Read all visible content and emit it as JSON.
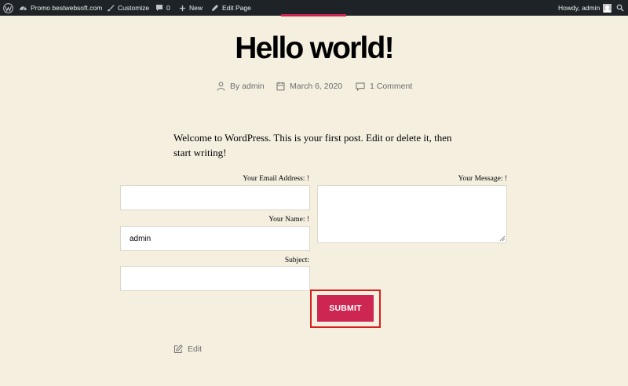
{
  "adminbar": {
    "site_name": "Promo bestwebsoft.com",
    "customize": "Customize",
    "comments_count": "0",
    "new": "New",
    "edit_page": "Edit Page",
    "howdy": "Howdy, admin"
  },
  "post": {
    "title": "Hello world!",
    "author": "By admin",
    "date": "March 6, 2020",
    "comments": "1 Comment",
    "body": "Welcome to WordPress. This is your first post. Edit or delete it, then start writing!",
    "edit": "Edit"
  },
  "form": {
    "email_label": "Your Email Address: !",
    "email_value": "",
    "name_label": "Your Name: !",
    "name_value": "admin",
    "subject_label": "Subject:",
    "subject_value": "",
    "message_label": "Your Message: !",
    "message_value": "",
    "submit_label": "SUBMIT"
  },
  "colors": {
    "accent": "#cd2653",
    "background": "#f5efe0",
    "adminbar": "#1d2327",
    "highlight_box": "#d52020"
  }
}
